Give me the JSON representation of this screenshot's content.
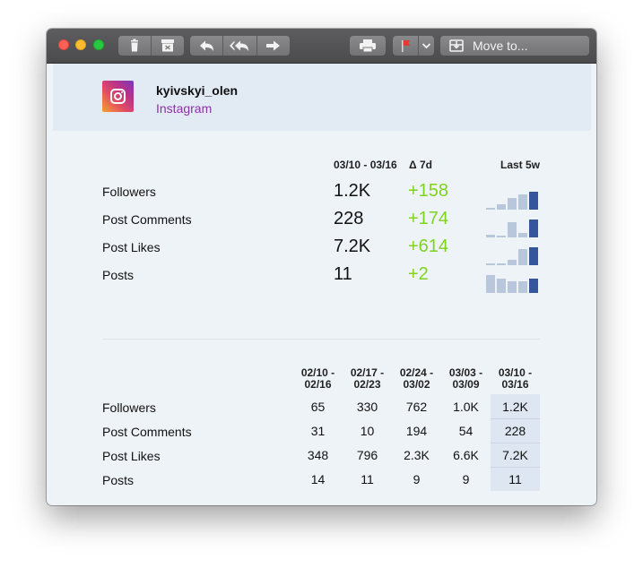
{
  "toolbar": {
    "buttons": [
      "trash-icon",
      "archive-icon",
      "reply-icon",
      "reply-all-icon",
      "forward-icon",
      "print-icon",
      "flag-icon",
      "chevron-down-icon",
      "move-icon"
    ],
    "move_to_label": "Move to..."
  },
  "account": {
    "username": "kyivskyi_olen",
    "platform": "Instagram",
    "platform_color": "#8a33a6"
  },
  "summary": {
    "period_header": "03/10 - 03/16",
    "delta_header": "Δ 7d",
    "trend_header": "Last 5w",
    "delta_color": "#7ed321",
    "rows": [
      {
        "label": "Followers",
        "value": "1.2K",
        "delta": "+158",
        "trend": [
          65,
          330,
          762,
          1000,
          1200
        ]
      },
      {
        "label": "Post Comments",
        "value": "228",
        "delta": "+174",
        "trend": [
          31,
          10,
          194,
          54,
          228
        ]
      },
      {
        "label": "Post Likes",
        "value": "7.2K",
        "delta": "+614",
        "trend": [
          348,
          796,
          2300,
          6600,
          7200
        ]
      },
      {
        "label": "Posts",
        "value": "11",
        "delta": "+2",
        "trend": [
          14,
          11,
          9,
          9,
          11
        ]
      }
    ]
  },
  "weekly": {
    "columns": [
      {
        "line1": "02/10 -",
        "line2": "02/16"
      },
      {
        "line1": "02/17 -",
        "line2": "02/23"
      },
      {
        "line1": "02/24 -",
        "line2": "03/02"
      },
      {
        "line1": "03/03 -",
        "line2": "03/09"
      },
      {
        "line1": "03/10 -",
        "line2": "03/16"
      }
    ],
    "rows": [
      {
        "label": "Followers",
        "values": [
          "65",
          "330",
          "762",
          "1.0K",
          "1.2K"
        ]
      },
      {
        "label": "Post Comments",
        "values": [
          "31",
          "10",
          "194",
          "54",
          "228"
        ]
      },
      {
        "label": "Post Likes",
        "values": [
          "348",
          "796",
          "2.3K",
          "6.6K",
          "7.2K"
        ]
      },
      {
        "label": "Posts",
        "values": [
          "14",
          "11",
          "9",
          "9",
          "11"
        ]
      }
    ]
  }
}
